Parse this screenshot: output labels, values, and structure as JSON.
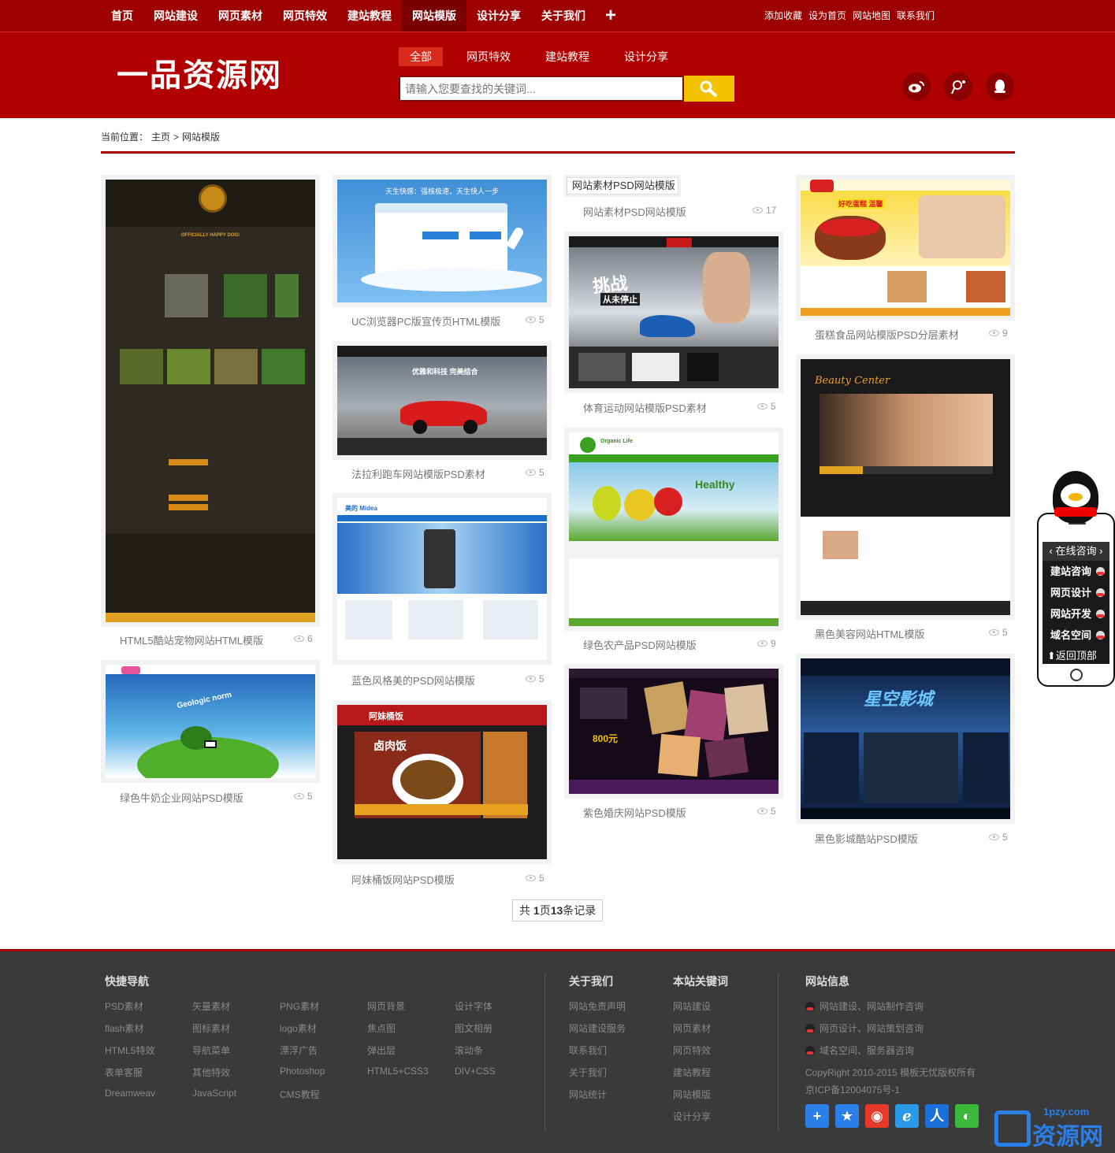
{
  "topnav": {
    "items": [
      "首页",
      "网站建设",
      "网页素材",
      "网页特效",
      "建站教程",
      "网站模版",
      "设计分享",
      "关于我们"
    ],
    "active": "网站模版",
    "plus": "+",
    "right_links": [
      "添加收藏",
      "设为首页",
      "网站地图",
      "联系我们"
    ]
  },
  "header": {
    "logo": "一品资源网",
    "search_tabs": [
      "全部",
      "网页特效",
      "建站教程",
      "设计分享"
    ],
    "active_tab": "全部",
    "search_placeholder": "请输入您要查找的关键词...",
    "search_icon": "search-icon",
    "social_icons": [
      "weibo-icon",
      "tencent-weibo-icon",
      "qq-icon"
    ]
  },
  "breadcrumb": {
    "label": "当前位置：",
    "home": "主页",
    "sep": ">",
    "current": "网站模版"
  },
  "cards": [
    {
      "title": "HTML5酷站宠物网站HTML模版",
      "views": "6",
      "theme": "pet"
    },
    {
      "title": "绿色牛奶企业网站PSD模版",
      "views": "5",
      "theme": "milk"
    },
    {
      "title": "UC浏览器PC版宣传页HTML模版",
      "views": "5",
      "theme": "uc"
    },
    {
      "title": "法拉利跑车网站模版PSD素材",
      "views": "5",
      "theme": "car"
    },
    {
      "title": "蓝色风格美的PSD网站模版",
      "views": "5",
      "theme": "midea"
    },
    {
      "title": "阿妹桶饭网站PSD模版",
      "views": "5",
      "theme": "food"
    },
    {
      "title": "网站素材PSD网站模版",
      "views": "17",
      "theme": "broken",
      "alt": "网站素材PSD网站模版"
    },
    {
      "title": "体育运动网站模版PSD素材",
      "views": "5",
      "theme": "sport"
    },
    {
      "title": "绿色农产品PSD网站模版",
      "views": "9",
      "theme": "farm"
    },
    {
      "title": "紫色婚庆网站PSD模版",
      "views": "5",
      "theme": "wedding"
    },
    {
      "title": "蛋糕食品网站模版PSD分层素材",
      "views": "9",
      "theme": "cake"
    },
    {
      "title": "黑色美容网站HTML模版",
      "views": "5",
      "theme": "beauty"
    },
    {
      "title": "黑色影城酷站PSD模版",
      "views": "5",
      "theme": "cinema"
    }
  ],
  "thumbtext": {
    "uc_slogan": "天生快感：强核极速，天生快人一步",
    "car_slogan": "优雅和科技 完美结合",
    "midea_logo": "美的 Midea",
    "food_logo": "阿妹桶饭",
    "food_dish": "卤肉饭",
    "sport_title": "挑战",
    "sport_sub": "从未停止",
    "farm_logo": "Organic Life",
    "farm_title": "Healthy",
    "wedding_price": "800元",
    "beauty_title": "Beauty Center",
    "cinema_title": "星空影城",
    "milk_title": "Geologic norm",
    "pet_title": "OFFICIALLY HAPPY DOG!",
    "cake_title": "好吃蛋糕 温馨"
  },
  "pager": {
    "prefix": "共 ",
    "pages": "1",
    "mid": "页",
    "count": "13",
    "suffix": "条记录"
  },
  "qq_widget": {
    "header": "在线咨询",
    "items": [
      "建站咨询",
      "网页设计",
      "网站开发",
      "域名空间"
    ],
    "back_top": "返回顶部"
  },
  "footer": {
    "quick_nav_title": "快捷导航",
    "quick_nav_cols": [
      [
        "PSD素材",
        "flash素材",
        "HTML5特效",
        "表单客服",
        "Dreamweav"
      ],
      [
        "矢量素材",
        "图标素材",
        "导航菜单",
        "其他特效",
        "JavaScript"
      ],
      [
        "PNG素材",
        "logo素材",
        "漂浮广告",
        "Photoshop",
        "CMS教程"
      ],
      [
        "网页背景",
        "焦点图",
        "弹出层",
        "HTML5+CSS3"
      ],
      [
        "设计字体",
        "图文相册",
        "滚动条",
        "DIV+CSS"
      ]
    ],
    "about_title": "关于我们",
    "about_links": [
      "网站免责声明",
      "网站建设服务",
      "联系我们",
      "关于我们",
      "网站统计"
    ],
    "keywords_title": "本站关键词",
    "keywords_links": [
      "网站建设",
      "网页素材",
      "网页特效",
      "建站教程",
      "网站模版",
      "设计分享"
    ],
    "info_title": "网站信息",
    "info_links": [
      "网站建设、网站制作咨询",
      "网页设计、网站策划咨询",
      "域名空间、服务器咨询"
    ],
    "copyright": "CopyRight 2010-2015 模板无忧版权所有",
    "icp": "京ICP备12004075号-1",
    "share_icons": [
      "share-plus-icon",
      "qzone-icon",
      "weibo-icon",
      "tencent-weibo-icon",
      "renren-icon",
      "wechat-icon"
    ],
    "watermark_domain": "1pzy.com",
    "watermark_name": "资源网"
  },
  "colors": {
    "brand_red": "#b00000",
    "nav_red": "#9e0000",
    "search_yellow": "#f2c200",
    "footer_bg": "#3a3a3a"
  }
}
